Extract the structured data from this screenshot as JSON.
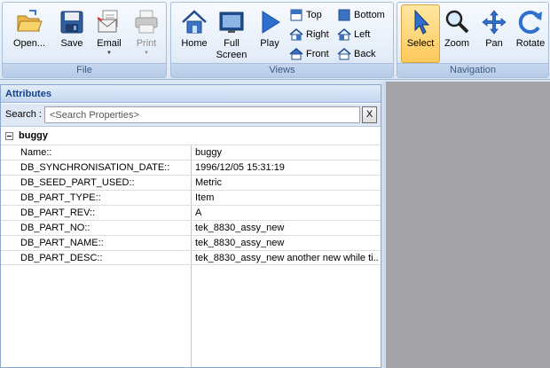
{
  "ribbon": {
    "file": {
      "label": "File",
      "open": "Open...",
      "save": "Save",
      "email": "Email",
      "print": "Print"
    },
    "views": {
      "label": "Views",
      "home": "Home",
      "full_screen_1": "Full",
      "full_screen_2": "Screen",
      "play": "Play",
      "top": "Top",
      "bottom": "Bottom",
      "right": "Right",
      "left": "Left",
      "front": "Front",
      "back": "Back"
    },
    "navigation": {
      "label": "Navigation",
      "select": "Select",
      "zoom": "Zoom",
      "pan": "Pan",
      "rotate": "Rotate"
    }
  },
  "attributes": {
    "title": "Attributes",
    "search_label": "Search :",
    "search_placeholder": "<Search Properties>",
    "clear_label": "X",
    "group_name": "buggy",
    "rows": [
      {
        "key": "Name::",
        "value": "buggy"
      },
      {
        "key": "DB_SYNCHRONISATION_DATE::",
        "value": "1996/12/05 15:31:19"
      },
      {
        "key": "DB_SEED_PART_USED::",
        "value": "Metric"
      },
      {
        "key": "DB_PART_TYPE::",
        "value": "Item"
      },
      {
        "key": "DB_PART_REV::",
        "value": "A"
      },
      {
        "key": "DB_PART_NO::",
        "value": "tek_8830_assy_new"
      },
      {
        "key": "DB_PART_NAME::",
        "value": "tek_8830_assy_new"
      },
      {
        "key": "DB_PART_DESC::",
        "value": "tek_8830_assy_new another new while ti..."
      }
    ]
  },
  "colors": {
    "ribbon_bg": "#dde8f5",
    "selected_tool": "#ffc95a",
    "viewport_bg": "#a3a3a8",
    "panel_header_text": "#15428b"
  }
}
